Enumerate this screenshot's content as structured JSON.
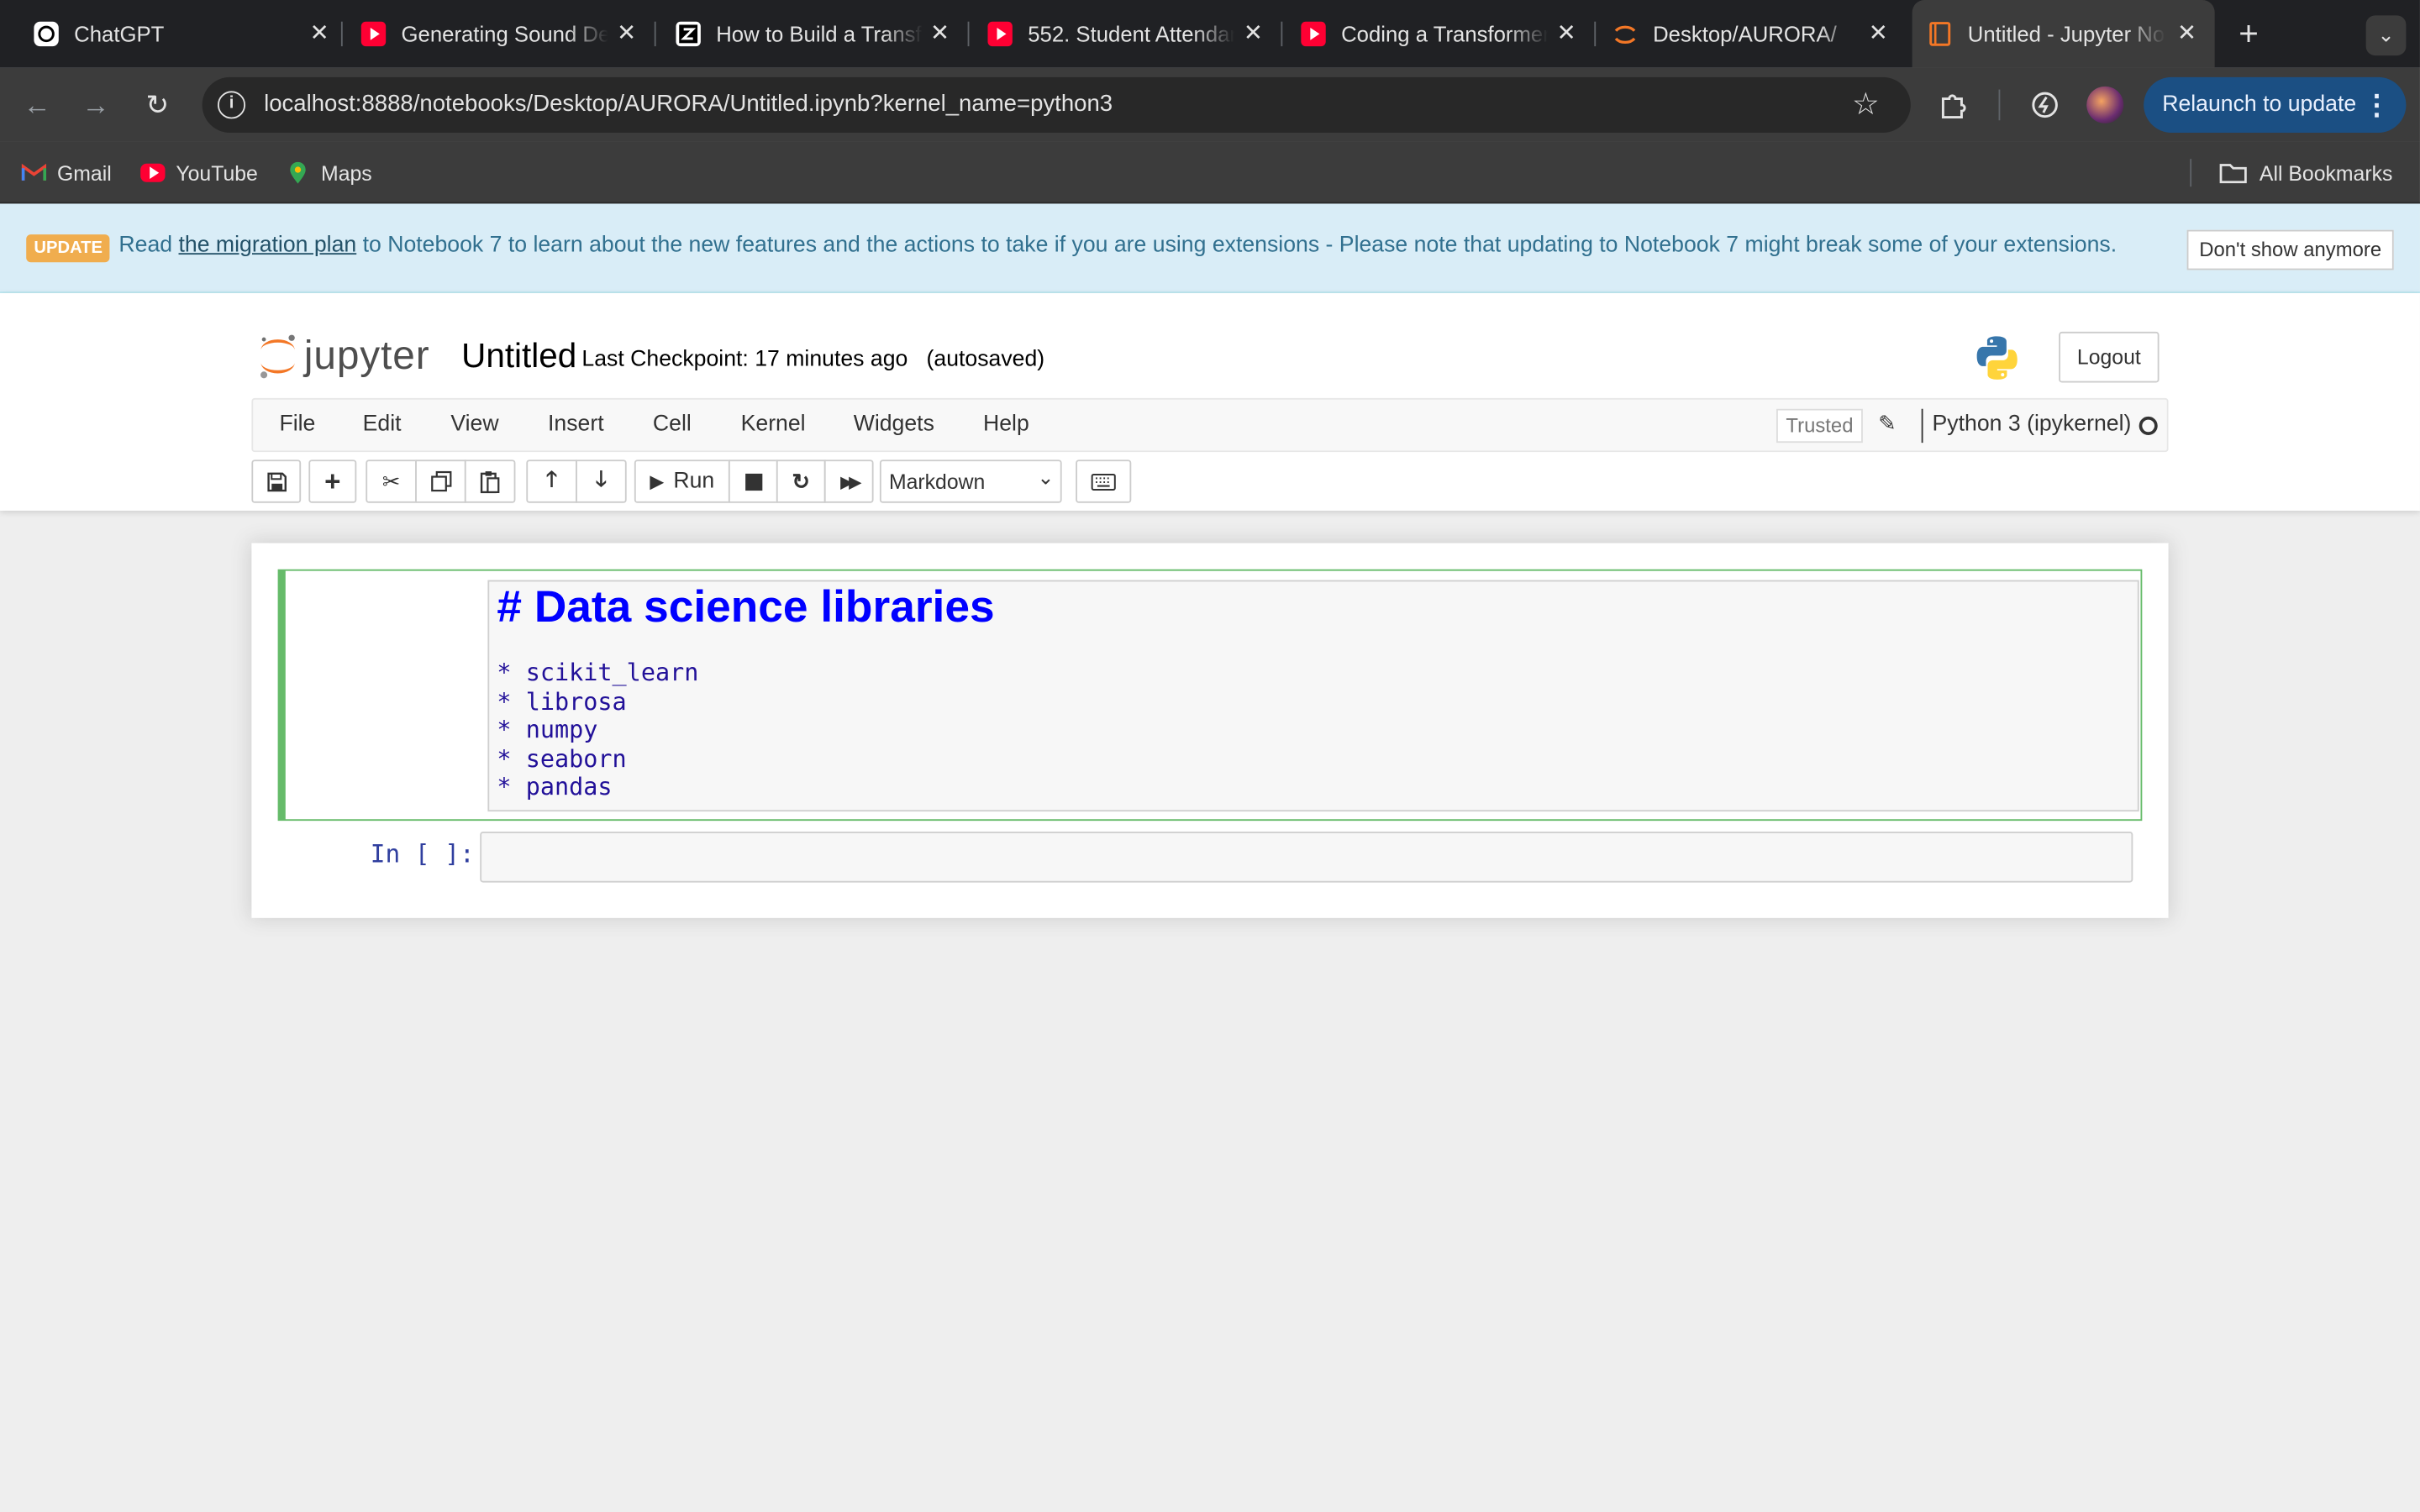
{
  "browser": {
    "tabs": [
      {
        "title": "ChatGPT",
        "icon": "chatgpt-icon"
      },
      {
        "title": "Generating Sound Design",
        "icon": "youtube-icon"
      },
      {
        "title": "How to Build a Transformer",
        "icon": "app-icon"
      },
      {
        "title": "552. Student Attendance",
        "icon": "youtube-icon"
      },
      {
        "title": "Coding a Transformer",
        "icon": "youtube-icon"
      },
      {
        "title": "Desktop/AURORA/",
        "icon": "jupyter-icon"
      },
      {
        "title": "Untitled - Jupyter Notebook",
        "icon": "notebook-icon"
      }
    ],
    "url": "localhost:8888/notebooks/Desktop/AURORA/Untitled.ipynb?kernel_name=python3",
    "relaunch_label": "Relaunch to update",
    "bookmarks": [
      "Gmail",
      "YouTube",
      "Maps"
    ],
    "all_bookmarks_label": "All Bookmarks"
  },
  "banner": {
    "badge": "UPDATE",
    "text_before": "Read ",
    "link_text": "the migration plan",
    "text_after": " to Notebook 7 to learn about the new features and the actions to take if you are using extensions - Please note that updating to Notebook 7 might break some of your extensions.",
    "dismiss_label": "Don't show anymore"
  },
  "header": {
    "logo_text": "jupyter",
    "notebook_title": "Untitled",
    "checkpoint": "Last Checkpoint: 17 minutes ago   (autosaved)",
    "logout_label": "Logout"
  },
  "menu": {
    "items": [
      "File",
      "Edit",
      "View",
      "Insert",
      "Cell",
      "Kernel",
      "Widgets",
      "Help"
    ],
    "trusted_label": "Trusted",
    "kernel_name": "Python 3 (ipykernel)"
  },
  "toolbar": {
    "run_label": "Run",
    "cell_type": "Markdown"
  },
  "cells": {
    "markdown_heading": "# Data science libraries",
    "markdown_items": [
      "* scikit_learn",
      "* librosa",
      "* numpy",
      "* seaborn",
      "* pandas"
    ],
    "code_prompt": "In [ ]:"
  }
}
